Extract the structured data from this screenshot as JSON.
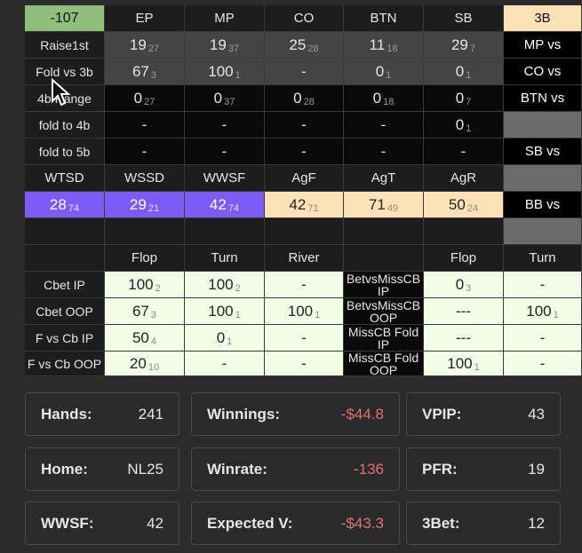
{
  "top_left_value": "-107",
  "positions_header": [
    "EP",
    "MP",
    "CO",
    "BTN",
    "SB"
  ],
  "threebet_header": "3B",
  "row_labels": [
    "Raise1st",
    "Fold vs 3b",
    "4b Range",
    "fold to 4b",
    "fold to 5b"
  ],
  "rows": [
    [
      [
        "19",
        "27"
      ],
      [
        "19",
        "37"
      ],
      [
        "25",
        "28"
      ],
      [
        "11",
        "18"
      ],
      [
        "29",
        "7"
      ]
    ],
    [
      [
        "67",
        "3"
      ],
      [
        "100",
        "1"
      ],
      [
        "-",
        ""
      ],
      [
        "0",
        "1"
      ],
      [
        "0",
        "1"
      ]
    ],
    [
      [
        "0",
        "27"
      ],
      [
        "0",
        "37"
      ],
      [
        "0",
        "28"
      ],
      [
        "0",
        "18"
      ],
      [
        "0",
        "7"
      ]
    ],
    [
      [
        "-",
        ""
      ],
      [
        "-",
        ""
      ],
      [
        "-",
        ""
      ],
      [
        "-",
        ""
      ],
      [
        "0",
        "1"
      ]
    ],
    [
      [
        "-",
        ""
      ],
      [
        "-",
        ""
      ],
      [
        "-",
        ""
      ],
      [
        "-",
        ""
      ],
      [
        "-",
        ""
      ]
    ]
  ],
  "vs_labels": [
    "MP vs",
    "CO vs",
    "BTN vs",
    "",
    "SB vs",
    "",
    "BB vs",
    ""
  ],
  "wt_headers": [
    "WTSD",
    "WSSD",
    "WWSF",
    "AgF",
    "AgT",
    "AgR"
  ],
  "wt_values": [
    [
      "28",
      "74"
    ],
    [
      "29",
      "21"
    ],
    [
      "42",
      "74"
    ],
    [
      "42",
      "71"
    ],
    [
      "71",
      "49"
    ],
    [
      "50",
      "24"
    ]
  ],
  "street_headers_left": [
    "Flop",
    "Turn",
    "River"
  ],
  "street_headers_right": [
    "Flop",
    "Turn"
  ],
  "cbet_rows": [
    {
      "label": "Cbet IP",
      "left": [
        [
          "100",
          "2"
        ],
        [
          "100",
          "2"
        ],
        [
          "-",
          ""
        ]
      ],
      "mid": "BetvsMissCB IP",
      "right": [
        [
          "0",
          "3"
        ],
        [
          "-",
          ""
        ]
      ]
    },
    {
      "label": "Cbet OOP",
      "left": [
        [
          "67",
          "3"
        ],
        [
          "100",
          "1"
        ],
        [
          "100",
          "1"
        ]
      ],
      "mid": "BetvsMissCB OOP",
      "right": [
        [
          "---",
          ""
        ],
        [
          "100",
          "1"
        ]
      ]
    },
    {
      "label": "F vs Cb IP",
      "left": [
        [
          "50",
          "4"
        ],
        [
          "0",
          "1"
        ],
        [
          "-",
          ""
        ]
      ],
      "mid": "MissCB Fold IP",
      "right": [
        [
          "---",
          ""
        ],
        [
          "-",
          ""
        ]
      ]
    },
    {
      "label": "F vs Cb OOP",
      "left": [
        [
          "20",
          "10"
        ],
        [
          "-",
          ""
        ],
        [
          "-",
          ""
        ]
      ],
      "mid": "MissCB Fold OOP",
      "right": [
        [
          "100",
          "1"
        ],
        [
          "-",
          ""
        ]
      ]
    }
  ],
  "cards": [
    {
      "k": "Hands:",
      "v": "241",
      "neg": false
    },
    {
      "k": "Winnings:",
      "v": "-$44.8",
      "neg": true
    },
    {
      "k": "VPIP:",
      "v": "43",
      "neg": false
    },
    {
      "k": "Home:",
      "v": "NL25",
      "neg": false
    },
    {
      "k": "Winrate:",
      "v": "-136",
      "neg": true
    },
    {
      "k": "PFR:",
      "v": "19",
      "neg": false
    },
    {
      "k": "WWSF:",
      "v": "42",
      "neg": false
    },
    {
      "k": "Expected V:",
      "v": "-$43.3",
      "neg": true
    },
    {
      "k": "3Bet:",
      "v": "12",
      "neg": false
    }
  ],
  "colors": {
    "purple": "#7b5cf5",
    "peach": "#fde2b8",
    "light": "#f1fde7",
    "green": "#8fbe7d",
    "negative": "#e27171"
  }
}
